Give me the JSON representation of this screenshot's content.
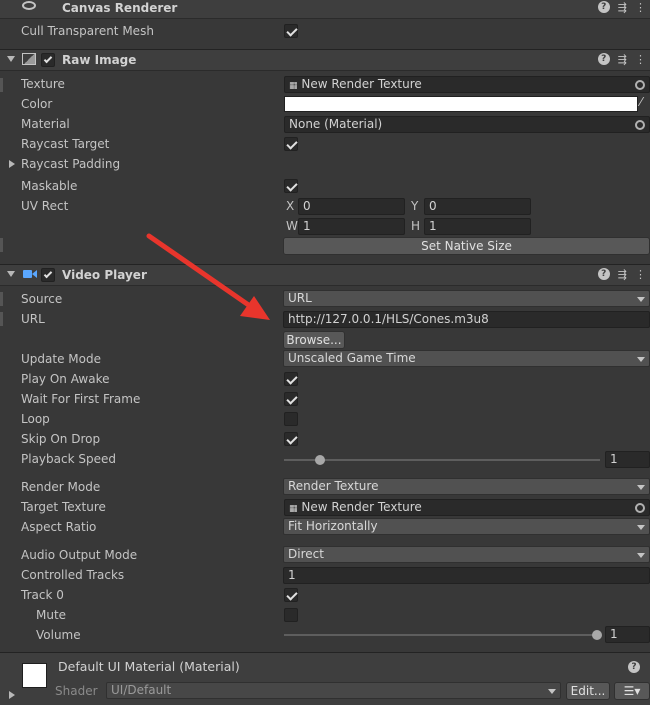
{
  "canvas_renderer": {
    "title": "Canvas Renderer",
    "cull_label": "Cull Transparent Mesh",
    "cull_checked": true
  },
  "raw_image": {
    "title": "Raw Image",
    "enabled": true,
    "texture_label": "Texture",
    "texture_value": "New Render Texture",
    "color_label": "Color",
    "color_value": "#ffffff",
    "material_label": "Material",
    "material_value": "None (Material)",
    "raycast_target_label": "Raycast Target",
    "raycast_target_checked": true,
    "raycast_padding_label": "Raycast Padding",
    "maskable_label": "Maskable",
    "maskable_checked": true,
    "uv_rect_label": "UV Rect",
    "uv": {
      "x_label": "X",
      "x": "0",
      "y_label": "Y",
      "y": "0",
      "w_label": "W",
      "w": "1",
      "h_label": "H",
      "h": "1"
    },
    "set_native_size": "Set Native Size"
  },
  "video_player": {
    "title": "Video Player",
    "enabled": true,
    "source_label": "Source",
    "source_value": "URL",
    "url_label": "URL",
    "url_value": "http://127.0.0.1/HLS/Cones.m3u8",
    "browse": "Browse...",
    "update_mode_label": "Update Mode",
    "update_mode_value": "Unscaled Game Time",
    "play_on_awake_label": "Play On Awake",
    "play_on_awake_checked": true,
    "wait_first_frame_label": "Wait For First Frame",
    "wait_first_frame_checked": true,
    "loop_label": "Loop",
    "loop_checked": false,
    "skip_on_drop_label": "Skip On Drop",
    "skip_on_drop_checked": true,
    "playback_speed_label": "Playback Speed",
    "playback_speed_value": "1",
    "render_mode_label": "Render Mode",
    "render_mode_value": "Render Texture",
    "target_texture_label": "Target Texture",
    "target_texture_value": "New Render Texture",
    "aspect_ratio_label": "Aspect Ratio",
    "aspect_ratio_value": "Fit Horizontally",
    "audio_output_label": "Audio Output Mode",
    "audio_output_value": "Direct",
    "controlled_tracks_label": "Controlled Tracks",
    "controlled_tracks_value": "1",
    "track0_label": "Track 0",
    "track0_checked": true,
    "mute_label": "Mute",
    "mute_checked": false,
    "volume_label": "Volume",
    "volume_value": "1"
  },
  "material": {
    "title": "Default UI Material (Material)",
    "shader_label": "Shader",
    "shader_value": "UI/Default",
    "edit": "Edit..."
  },
  "colors": {
    "background": "#383838",
    "header": "#3e3e3e",
    "field": "#2a2a2a",
    "arrow": "#e8352c",
    "video_icon": "#5aa7ff"
  }
}
